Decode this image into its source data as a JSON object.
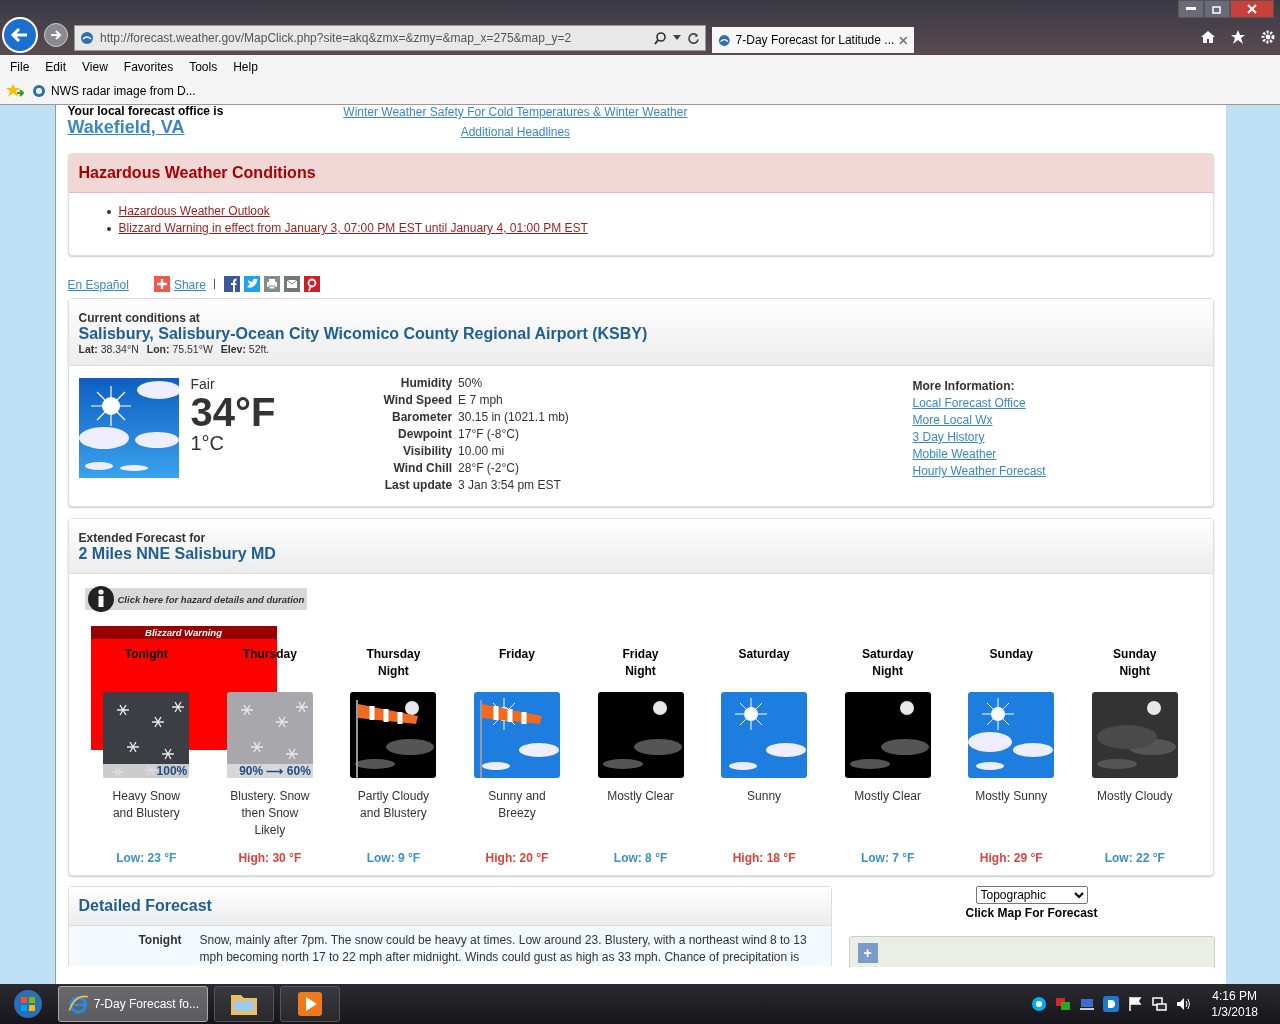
{
  "browser": {
    "address": "http://forecast.weather.gov/MapClick.php?site=akq&zmx=&zmy=&map_x=275&map_y=2",
    "tabs": [
      {
        "title": "7-Day Forecast for Latitude ...",
        "selected": true
      }
    ],
    "menu": [
      "File",
      "Edit",
      "View",
      "Favorites",
      "Tools",
      "Help"
    ],
    "favorites": [
      "NWS radar image from D..."
    ]
  },
  "header": {
    "office_label": "Your local forecast office is",
    "office": "Wakefield, VA",
    "headline_link": "Winter Weather Safety For Cold Temperatures & Winter Weather",
    "additional": "Additional Headlines"
  },
  "hazards": {
    "title": "Hazardous Weather Conditions",
    "items": [
      "Hazardous Weather Outlook",
      "Blizzard Warning in effect from January 3, 07:00 PM EST until January 4, 01:00 PM EST"
    ]
  },
  "share": {
    "language": "En Español",
    "share": "Share"
  },
  "current": {
    "label": "Current conditions at",
    "station": "Salisbury, Salisbury-Ocean City Wicomico County Regional Airport (KSBY)",
    "coords": [
      {
        "label": "Lat:",
        "value": "38.34°N"
      },
      {
        "label": "Lon:",
        "value": "75.51°W"
      },
      {
        "label": "Elev:",
        "value": "52ft."
      }
    ],
    "condition": "Fair",
    "temp_f": "34°F",
    "temp_c": "1°C",
    "details": [
      {
        "label": "Humidity",
        "value": "50%"
      },
      {
        "label": "Wind Speed",
        "value": "E 7 mph"
      },
      {
        "label": "Barometer",
        "value": "30.15 in (1021.1 mb)"
      },
      {
        "label": "Dewpoint",
        "value": "17°F (-8°C)"
      },
      {
        "label": "Visibility",
        "value": "10.00 mi"
      },
      {
        "label": "Wind Chill",
        "value": "28°F (-2°C)"
      },
      {
        "label": "Last update",
        "value": "3 Jan 3:54 pm EST"
      }
    ],
    "more_title": "More Information:",
    "links": [
      "Local Forecast Office",
      "More Local Wx",
      "3 Day History",
      "Mobile Weather",
      "Hourly Weather Forecast"
    ]
  },
  "extended": {
    "label": "Extended Forecast for",
    "location": "2 Miles NNE Salisbury MD",
    "hazard_button": "Click here for hazard details and duration",
    "hazard_title": "Blizzard Warning",
    "periods": [
      {
        "name": [
          "Tonight"
        ],
        "kind": "snow-dark",
        "chance": "100%",
        "desc": "Heavy Snow and Blustery",
        "temp": "Low: 23 °F",
        "high": false
      },
      {
        "name": [
          "Thursday"
        ],
        "kind": "snow-light",
        "chance": "90% ⟶ 60%",
        "desc": "Blustery. Snow then Snow Likely",
        "temp": "High: 30 °F",
        "high": true
      },
      {
        "name": [
          "Thursday",
          "Night"
        ],
        "kind": "windsock-night",
        "desc": "Partly Cloudy and Blustery",
        "temp": "Low: 9 °F",
        "high": false
      },
      {
        "name": [
          "Friday"
        ],
        "kind": "windsock-day",
        "desc": "Sunny and Breezy",
        "temp": "High: 20 °F",
        "high": true
      },
      {
        "name": [
          "Friday",
          "Night"
        ],
        "kind": "clear-night",
        "desc": "Mostly Clear",
        "temp": "Low: 8 °F",
        "high": false
      },
      {
        "name": [
          "Saturday"
        ],
        "kind": "sunny",
        "desc": "Sunny",
        "temp": "High: 18 °F",
        "high": true
      },
      {
        "name": [
          "Saturday",
          "Night"
        ],
        "kind": "clear-night",
        "desc": "Mostly Clear",
        "temp": "Low: 7 °F",
        "high": false
      },
      {
        "name": [
          "Sunday"
        ],
        "kind": "mostly-sunny",
        "desc": "Mostly Sunny",
        "temp": "High: 29 °F",
        "high": true
      },
      {
        "name": [
          "Sunday",
          "Night"
        ],
        "kind": "cloudy-night",
        "desc": "Mostly Cloudy",
        "temp": "Low: 22 °F",
        "high": false
      }
    ]
  },
  "detailed": {
    "title": "Detailed Forecast",
    "rows": [
      {
        "period": "Tonight",
        "text": "Snow, mainly after 7pm. The snow could be heavy at times. Low around 23. Blustery, with a northeast wind 8 to 13 mph becoming north 17 to 22 mph after midnight. Winds could gust as high as 33 mph. Chance of precipitation is"
      }
    ]
  },
  "map": {
    "layer": "Topographic",
    "caption": "Click Map For Forecast",
    "zoom": "+"
  },
  "taskbar": {
    "tasks": [
      {
        "kind": "ie",
        "label": "7-Day Forecast fo...",
        "selected": true
      },
      {
        "kind": "folder",
        "selected": false
      },
      {
        "kind": "media",
        "selected": false
      }
    ],
    "time": "4:16 PM",
    "date": "1/3/2018"
  }
}
